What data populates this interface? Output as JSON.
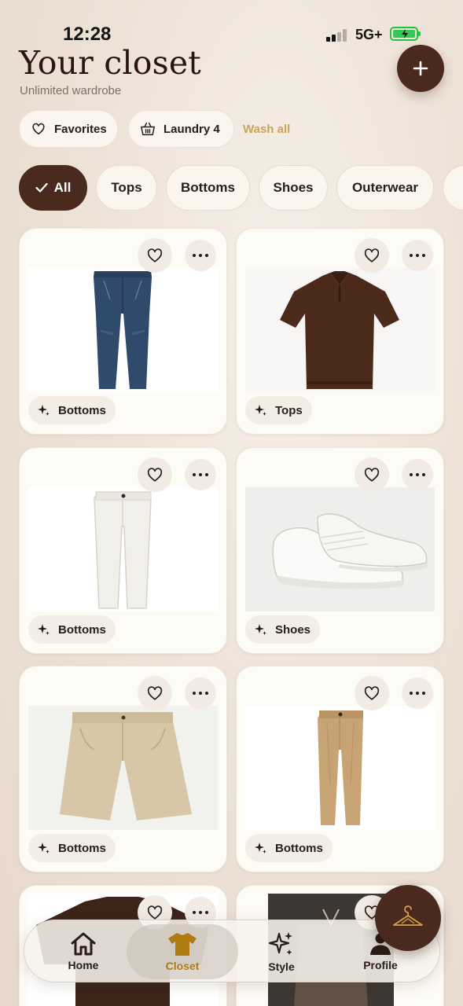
{
  "status": {
    "time": "12:28",
    "network": "5G+"
  },
  "header": {
    "title": "Your closet",
    "subtitle": "Unlimited wardrobe"
  },
  "actions": {
    "favorites": "Favorites",
    "laundry": "Laundry 4",
    "wash_all": "Wash all"
  },
  "filters": [
    "All",
    "Tops",
    "Bottoms",
    "Shoes",
    "Outerwear"
  ],
  "items": [
    {
      "category": "Bottoms",
      "image": "dark-blue-jeans"
    },
    {
      "category": "Tops",
      "image": "brown-polo-shirt"
    },
    {
      "category": "Bottoms",
      "image": "white-trousers"
    },
    {
      "category": "Shoes",
      "image": "white-sneakers"
    },
    {
      "category": "Bottoms",
      "image": "khaki-shorts"
    },
    {
      "category": "Bottoms",
      "image": "tan-trousers"
    }
  ],
  "nav": {
    "home": "Home",
    "closet": "Closet",
    "style": "Style",
    "profile": "Profile"
  },
  "colors": {
    "accent_brown": "#4a2a1f",
    "gold": "#c9a45a",
    "active_nav": "#b07a12"
  }
}
